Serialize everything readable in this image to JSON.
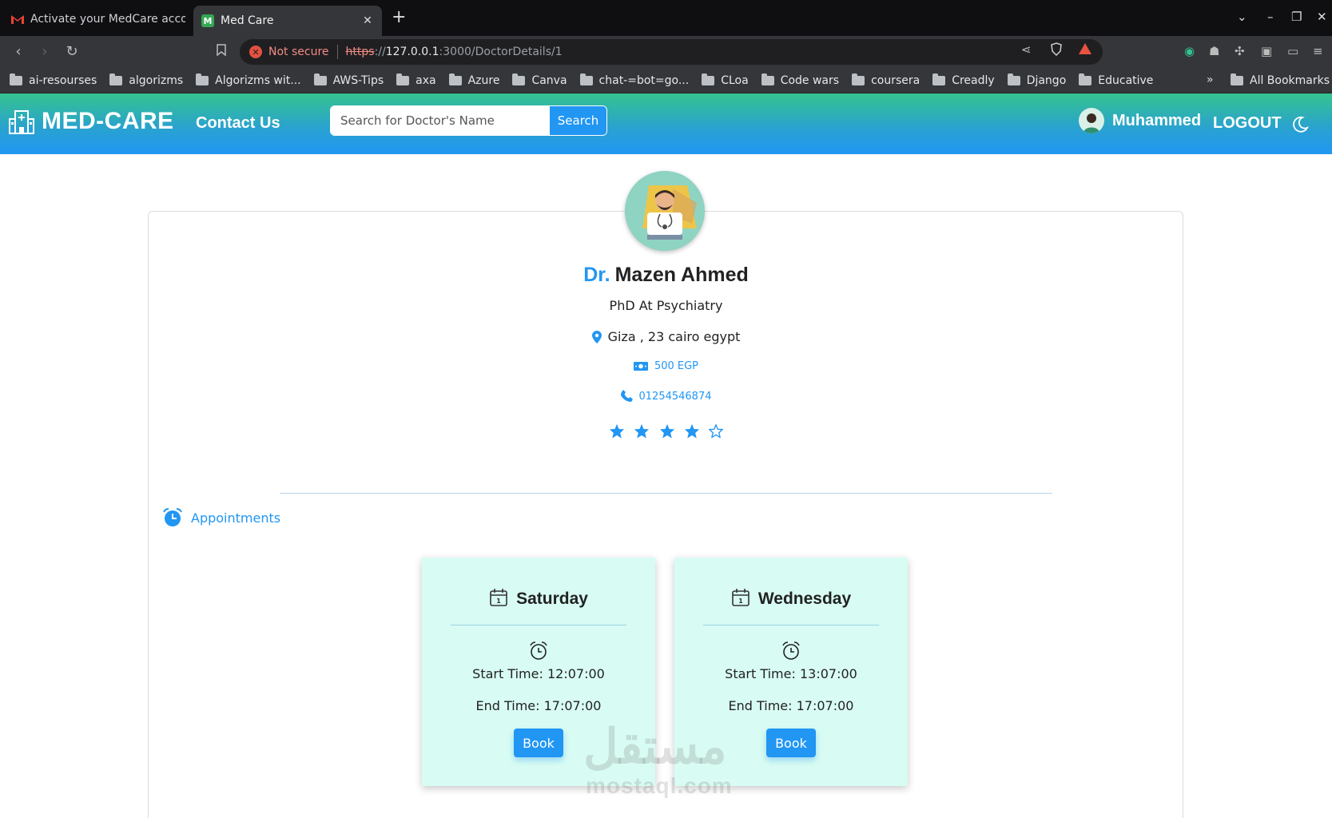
{
  "browser": {
    "tabs": [
      {
        "title": "Activate your MedCare acco",
        "favicon": "gmail-icon",
        "active": false
      },
      {
        "title": "Med Care",
        "favicon": "medcare-icon",
        "active": true
      }
    ],
    "address": {
      "security_label": "Not secure",
      "scheme": "https",
      "scheme_sep": "://",
      "host": "127.0.0.1",
      "path": ":3000/DoctorDetails/1"
    },
    "bookmarks": [
      "ai-resourses",
      "algorizms",
      "Algorizms wit...",
      "AWS-Tips",
      "axa",
      "Azure",
      "Canva",
      "chat-=bot=go...",
      "CLoa",
      "Code wars",
      "coursera",
      "Creadly",
      "Django",
      "Educative"
    ],
    "bookmarks_more": "»",
    "all_bookmarks": "All Bookmarks"
  },
  "navbar": {
    "brand": "MED-CARE",
    "contact": "Contact Us",
    "search_placeholder": "Search for Doctor's Name",
    "search_button": "Search",
    "user_name": "Muhammed",
    "logout": "LOGOUT"
  },
  "doctor": {
    "prefix": "Dr.",
    "name": "Mazen Ahmed",
    "degree": "PhD At Psychiatry",
    "address": "Giza , 23 cairo egypt",
    "price": "500 EGP",
    "phone": "01254546874",
    "rating": 4,
    "rating_max": 5
  },
  "appointments": {
    "title": "Appointments",
    "slots": [
      {
        "day": "Saturday",
        "start": "Start Time: 12:07:00",
        "end": "End Time: 17:07:00",
        "button": "Book"
      },
      {
        "day": "Wednesday",
        "start": "Start Time: 13:07:00",
        "end": "End Time: 17:07:00",
        "button": "Book"
      }
    ]
  },
  "watermark": {
    "main": "مستقل",
    "sub": "mostaql.com"
  },
  "colors": {
    "accent": "#2196f3",
    "nav_top": "#35c48d",
    "slot_bg": "#d8fcf3"
  }
}
